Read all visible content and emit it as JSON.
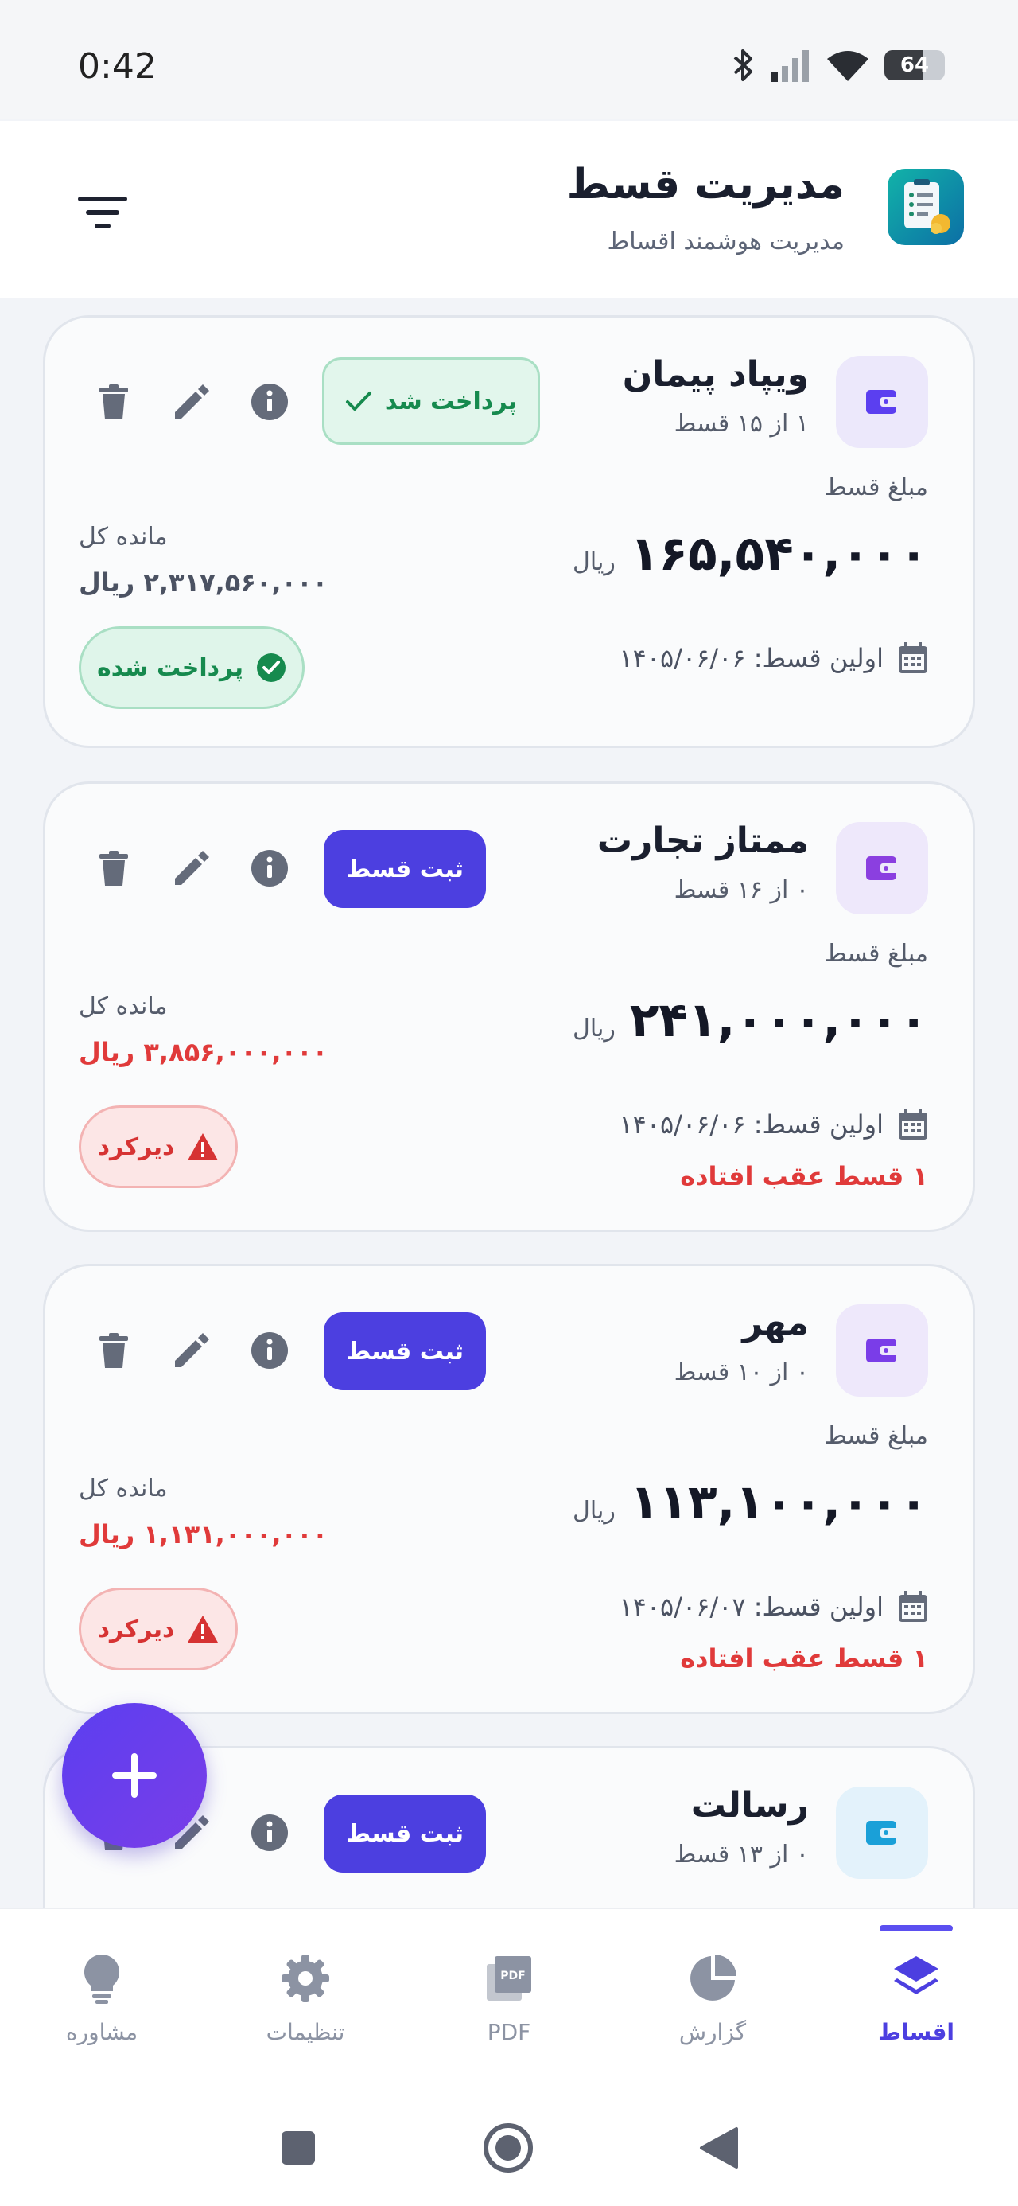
{
  "status_bar": {
    "time": "0:42",
    "battery": "64",
    "battery_level": 0.64
  },
  "header": {
    "title": "مدیریت قسط",
    "subtitle": "مدیریت هوشمند اقساط",
    "logo_icon": "checklist-app-icon",
    "filter_icon": "filter-icon"
  },
  "labels": {
    "amount_label": "مبلغ قسط",
    "remaining_label": "مانده کل",
    "currency": "ریال"
  },
  "cards": [
    {
      "name": "ویپاد پیمان",
      "progress": "۱ از ۱۵ قسط",
      "amount": "۱۶۵,۵۴۰,۰۰۰",
      "first_date": "اولین قسط: ۱۴۰۵/۰۶/۰۶",
      "remaining": "۲,۳۱۷,۵۶۰,۰۰۰ ریال",
      "status": "پرداخت شده",
      "action": "پرداخت شد",
      "overdue": ""
    },
    {
      "name": "ممتاز تجارت",
      "progress": "۰ از ۱۶ قسط",
      "amount": "۲۴۱,۰۰۰,۰۰۰",
      "first_date": "اولین قسط: ۱۴۰۵/۰۶/۰۶",
      "remaining": "۳,۸۵۶,۰۰۰,۰۰۰ ریال",
      "status": "دیرکرد",
      "action": "ثبت قسط",
      "overdue": "۱ قسط عقب افتاده"
    },
    {
      "name": "مهر",
      "progress": "۰ از ۱۰ قسط",
      "amount": "۱۱۳,۱۰۰,۰۰۰",
      "first_date": "اولین قسط: ۱۴۰۵/۰۶/۰۷",
      "remaining": "۱,۱۳۱,۰۰۰,۰۰۰ ریال",
      "status": "دیرکرد",
      "action": "ثبت قسط",
      "overdue": "۱ قسط عقب افتاده"
    },
    {
      "name": "رسالت",
      "progress": "۰ از ۱۳ قسط",
      "action": "ثبت قسط"
    }
  ],
  "nav": {
    "items": [
      {
        "label": "اقساط",
        "icon": "layers-icon",
        "active": true
      },
      {
        "label": "گزارش",
        "icon": "pie-chart-icon",
        "active": false
      },
      {
        "label": "PDF",
        "icon": "pdf-icon",
        "active": false
      },
      {
        "label": "تنظیمات",
        "icon": "gear-icon",
        "active": false
      },
      {
        "label": "مشاوره",
        "icon": "lightbulb-icon",
        "active": false
      }
    ]
  },
  "colors": {
    "primary": "#4c3fe0",
    "success": "#168a4e",
    "danger": "#e03a3a"
  }
}
